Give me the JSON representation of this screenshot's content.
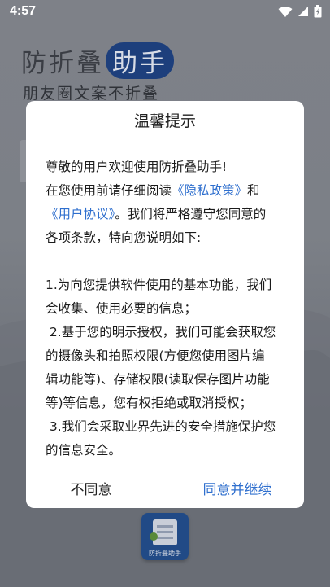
{
  "status_bar": {
    "time": "4:57",
    "icons": [
      "wifi-icon",
      "signal-icon",
      "battery-icon"
    ]
  },
  "background": {
    "title_prefix": "防折叠",
    "title_highlight": "助手",
    "subtitle": "朋友圈文案不折叠",
    "app_icon_label": "防折叠助手"
  },
  "dialog": {
    "title": "温馨提示",
    "greeting": "尊敬的用户欢迎使用防折叠助手!",
    "line2_prefix": "在您使用前请仔细阅读",
    "privacy_link": "《隐私政策》",
    "line2_and": "和",
    "agreement_link": "《用户协议》",
    "line3_suffix": "。我们将严格遵守您同意的",
    "line4": "各项条款，特向您说明如下:",
    "point1_a": "1.为向您提供软件使用的基本功能，我们",
    "point1_b": "会收集、使用必要的信息；",
    "point2_a": " 2.基于您的明示授权，我们可能会获取您",
    "point2_b": "的摄像头和拍照权限(方便您使用图片编",
    "point2_c": "辑功能等)、存储权限(读取保存图片功能",
    "point2_d": "等)等信息，您有权拒绝或取消授权；",
    "point3_a": " 3.我们会采取业界先进的安全措施保护您",
    "point3_b": "的信息安全。",
    "disagree_label": "不同意",
    "agree_label": "同意并继续"
  },
  "colors": {
    "link": "#2f6fce",
    "scrim": "#7c8087",
    "dialog_bg": "#ffffff",
    "brand_dark": "#1d3f7c"
  }
}
